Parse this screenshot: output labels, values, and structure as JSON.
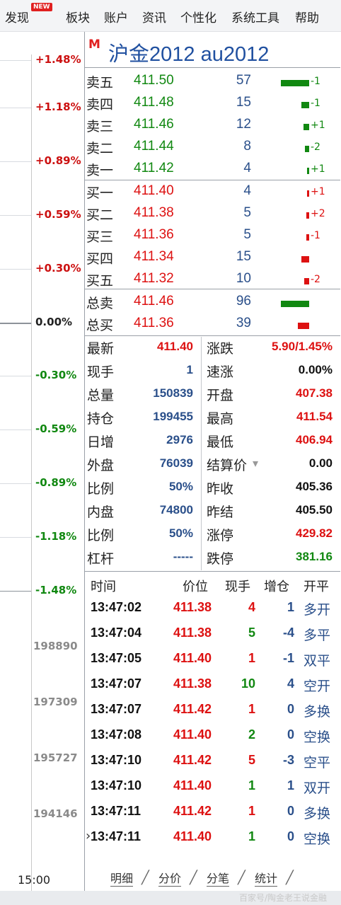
{
  "menu": [
    {
      "label": "发现",
      "badge": "NEW"
    },
    {
      "label": "板块"
    },
    {
      "label": "账户"
    },
    {
      "label": "资讯"
    },
    {
      "label": "个性化"
    },
    {
      "label": "系统工具"
    },
    {
      "label": "帮助"
    }
  ],
  "chart": {
    "pct_labels": [
      "+1.48%",
      "+1.18%",
      "+0.89%",
      "+0.59%",
      "+0.30%",
      "0.00%",
      "-0.30%",
      "-0.59%",
      "-0.89%",
      "-1.18%",
      "-1.48%"
    ],
    "vol_labels": [
      "198890",
      "197309",
      "195727",
      "194146"
    ],
    "time_label": "15:00"
  },
  "header": {
    "mark": "M",
    "title": "沪金2012  au2012"
  },
  "orderbook": {
    "asks": [
      {
        "label": "卖五",
        "price": "411.50",
        "vol": "57",
        "chg": "-1",
        "bar": 1.0
      },
      {
        "label": "卖四",
        "price": "411.48",
        "vol": "15",
        "chg": "-1",
        "bar": 0.27
      },
      {
        "label": "卖三",
        "price": "411.46",
        "vol": "12",
        "chg": "+1",
        "bar": 0.21
      },
      {
        "label": "卖二",
        "price": "411.44",
        "vol": "8",
        "chg": "-2",
        "bar": 0.14
      },
      {
        "label": "卖一",
        "price": "411.42",
        "vol": "4",
        "chg": "+1",
        "bar": 0.07
      }
    ],
    "bids": [
      {
        "label": "买一",
        "price": "411.40",
        "vol": "4",
        "chg": "+1",
        "bar": 0.07
      },
      {
        "label": "买二",
        "price": "411.38",
        "vol": "5",
        "chg": "+2",
        "bar": 0.09
      },
      {
        "label": "买三",
        "price": "411.36",
        "vol": "5",
        "chg": "-1",
        "bar": 0.09
      },
      {
        "label": "买四",
        "price": "411.34",
        "vol": "15",
        "chg": "",
        "bar": 0.27
      },
      {
        "label": "买五",
        "price": "411.32",
        "vol": "10",
        "chg": "-2",
        "bar": 0.18
      }
    ],
    "totals": [
      {
        "label": "总卖",
        "price": "411.46",
        "vol": "96",
        "bar": 1.0,
        "color": "green"
      },
      {
        "label": "总买",
        "price": "411.36",
        "vol": "39",
        "bar": 0.41,
        "color": "red"
      }
    ]
  },
  "stats_left": [
    {
      "label": "最新",
      "value": "411.40",
      "color": "red"
    },
    {
      "label": "现手",
      "value": "1",
      "color": "blue"
    },
    {
      "label": "总量",
      "value": "150839",
      "color": "blue"
    },
    {
      "label": "持仓",
      "value": "199455",
      "color": "blue"
    },
    {
      "label": "日增",
      "value": "2976",
      "color": "blue"
    },
    {
      "label": "外盘",
      "value": "76039",
      "color": "blue"
    },
    {
      "label": "比例",
      "value": "50%",
      "color": "blue"
    },
    {
      "label": "内盘",
      "value": "74800",
      "color": "blue"
    },
    {
      "label": "比例",
      "value": "50%",
      "color": "blue"
    },
    {
      "label": "杠杆",
      "value": "-----",
      "color": "blue"
    }
  ],
  "stats_right": [
    {
      "label": "涨跌",
      "value": "5.90/1.45%",
      "color": "red"
    },
    {
      "label": "速涨",
      "value": "0.00%",
      "color": "black"
    },
    {
      "label": "开盘",
      "value": "407.38",
      "color": "red"
    },
    {
      "label": "最高",
      "value": "411.54",
      "color": "red"
    },
    {
      "label": "最低",
      "value": "406.94",
      "color": "red"
    },
    {
      "label": "结算价",
      "value": "0.00",
      "color": "black",
      "dropdown": true
    },
    {
      "label": "昨收",
      "value": "405.36",
      "color": "black"
    },
    {
      "label": "昨结",
      "value": "405.50",
      "color": "black"
    },
    {
      "label": "涨停",
      "value": "429.82",
      "color": "red"
    },
    {
      "label": "跌停",
      "value": "381.16",
      "color": "green"
    }
  ],
  "ticks_header": [
    "时间",
    "价位",
    "现手",
    "增仓",
    "开平"
  ],
  "ticks": [
    {
      "time": "13:47:02",
      "price": "411.38",
      "hand": "4",
      "hand_color": "red",
      "inc": "1",
      "kind": "多开"
    },
    {
      "time": "13:47:04",
      "price": "411.38",
      "hand": "5",
      "hand_color": "green",
      "inc": "-4",
      "kind": "多平"
    },
    {
      "time": "13:47:05",
      "price": "411.40",
      "hand": "1",
      "hand_color": "red",
      "inc": "-1",
      "kind": "双平"
    },
    {
      "time": "13:47:07",
      "price": "411.38",
      "hand": "10",
      "hand_color": "green",
      "inc": "4",
      "kind": "空开"
    },
    {
      "time": "13:47:07",
      "price": "411.42",
      "hand": "1",
      "hand_color": "red",
      "inc": "0",
      "kind": "多换"
    },
    {
      "time": "13:47:08",
      "price": "411.40",
      "hand": "2",
      "hand_color": "green",
      "inc": "0",
      "kind": "空换"
    },
    {
      "time": "13:47:10",
      "price": "411.42",
      "hand": "5",
      "hand_color": "red",
      "inc": "-3",
      "kind": "空平"
    },
    {
      "time": "13:47:10",
      "price": "411.40",
      "hand": "1",
      "hand_color": "green",
      "inc": "1",
      "kind": "双开"
    },
    {
      "time": "13:47:11",
      "price": "411.42",
      "hand": "1",
      "hand_color": "red",
      "inc": "0",
      "kind": "多换"
    },
    {
      "time": "13:47:11",
      "price": "411.40",
      "hand": "1",
      "hand_color": "green",
      "inc": "0",
      "kind": "空换"
    }
  ],
  "tabs": [
    "明细",
    "分价",
    "分笔",
    "统计"
  ],
  "watermark": "百家号/陶金老王说金融"
}
